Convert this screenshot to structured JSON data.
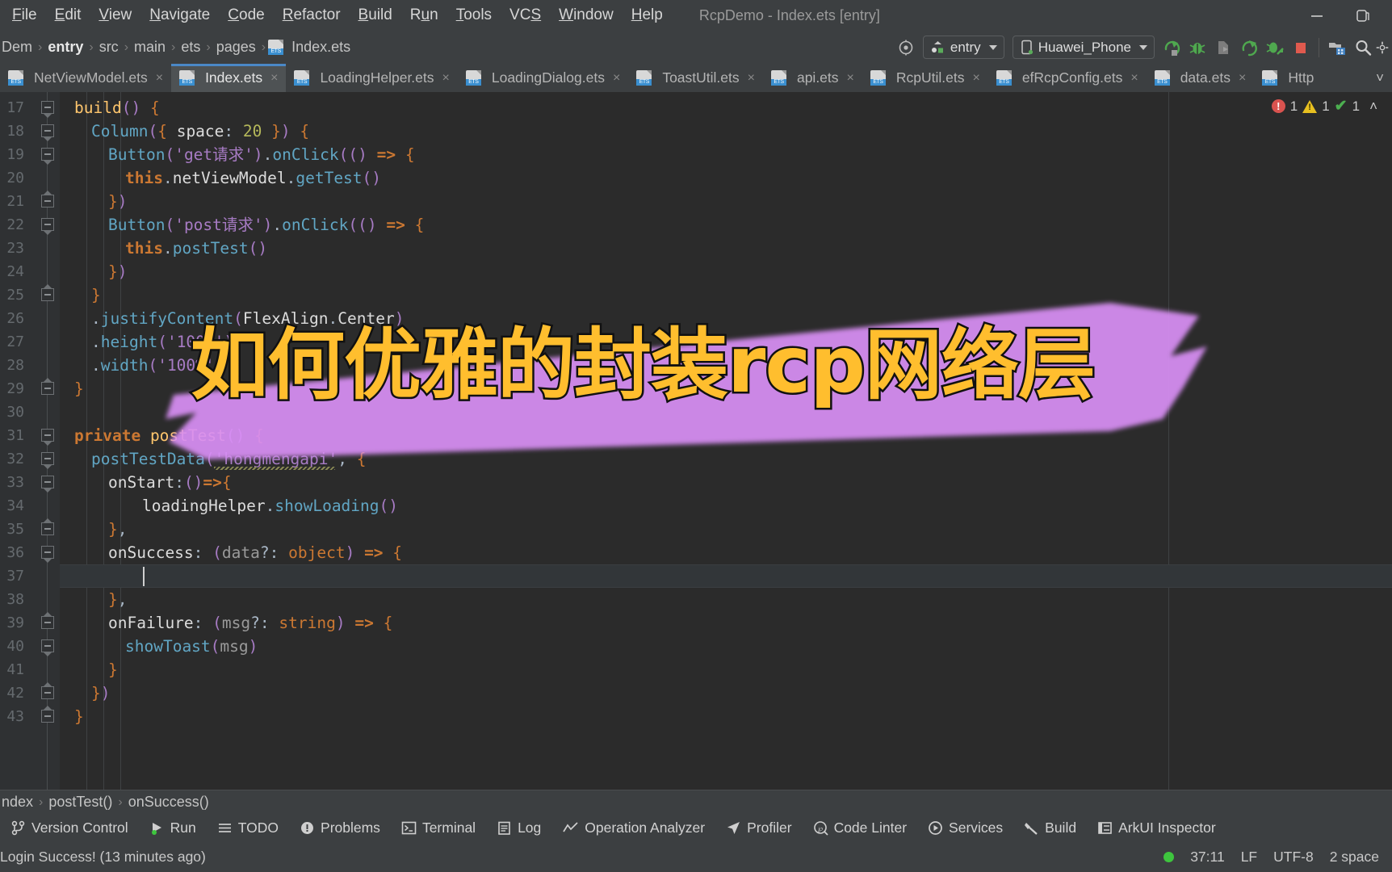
{
  "window": {
    "title": "RcpDemo - Index.ets [entry]",
    "minimize_label": "─",
    "restore_label": "❐"
  },
  "menubar": [
    {
      "label": "File",
      "mnemonic": "F"
    },
    {
      "label": "Edit",
      "mnemonic": "E"
    },
    {
      "label": "View",
      "mnemonic": "V"
    },
    {
      "label": "Navigate",
      "mnemonic": "N"
    },
    {
      "label": "Code",
      "mnemonic": "C"
    },
    {
      "label": "Refactor",
      "mnemonic": "R"
    },
    {
      "label": "Build",
      "mnemonic": "B"
    },
    {
      "label": "Run",
      "mnemonic": "u"
    },
    {
      "label": "Tools",
      "mnemonic": "T"
    },
    {
      "label": "VCS",
      "mnemonic": "S"
    },
    {
      "label": "Window",
      "mnemonic": "W"
    },
    {
      "label": "Help",
      "mnemonic": "H"
    }
  ],
  "breadcrumb": {
    "items": [
      "Dem",
      "entry",
      "src",
      "main",
      "ets",
      "pages",
      "Index.ets"
    ],
    "separator": "›",
    "file_icon": "ets-file-icon"
  },
  "toolbar": {
    "target_icon": "target-icon",
    "run_config": {
      "label": "entry",
      "icon": "module-icon"
    },
    "device": {
      "label": "Huawei_Phone",
      "icon": "phone-icon"
    },
    "actions": [
      {
        "name": "run-button",
        "icon": "run-arrow-icon",
        "color": "#5aab5a"
      },
      {
        "name": "debug-button",
        "icon": "bug-icon",
        "color": "#5aab5a"
      },
      {
        "name": "run-with-coverage",
        "icon": "coverage-icon",
        "color": "#8a8a8a"
      },
      {
        "name": "rerun-button",
        "icon": "rerun-icon",
        "color": "#5aab5a"
      },
      {
        "name": "attach-debugger",
        "icon": "attach-bug-icon",
        "color": "#5aab5a"
      },
      {
        "name": "stop-button",
        "icon": "stop-square-icon",
        "color": "#e05a4e"
      }
    ],
    "right_actions": [
      {
        "name": "project-structure-button",
        "icon": "project-structure-icon"
      },
      {
        "name": "search-everywhere-button",
        "icon": "search-icon"
      },
      {
        "name": "settings-button",
        "icon": "gear-icon"
      }
    ]
  },
  "tabs": {
    "items": [
      {
        "label": "NetViewModel.ets",
        "active": false
      },
      {
        "label": "Index.ets",
        "active": true
      },
      {
        "label": "LoadingHelper.ets",
        "active": false
      },
      {
        "label": "LoadingDialog.ets",
        "active": false
      },
      {
        "label": "ToastUtil.ets",
        "active": false
      },
      {
        "label": "api.ets",
        "active": false
      },
      {
        "label": "RcpUtil.ets",
        "active": false
      },
      {
        "label": "efRcpConfig.ets",
        "active": false
      },
      {
        "label": "data.ets",
        "active": false
      },
      {
        "label": "Http",
        "active": false
      }
    ],
    "close_label": "×",
    "more_label": "˅"
  },
  "inspections": {
    "errors": "1",
    "warnings": "1",
    "ok": "1",
    "collapse_label": "˄",
    "error_glyph": "!",
    "ok_glyph": "✔"
  },
  "editor": {
    "first_line": 17,
    "lines": [
      {
        "n": 17,
        "indent": 0,
        "tokens": [
          [
            "fn",
            "build"
          ],
          [
            "paren",
            "()"
          ],
          [
            "plain",
            " "
          ],
          [
            "brc",
            "{"
          ]
        ]
      },
      {
        "n": 18,
        "indent": 1,
        "tokens": [
          [
            "meth",
            "Column"
          ],
          [
            "paren",
            "("
          ],
          [
            "brc",
            "{"
          ],
          [
            "plain",
            " "
          ],
          [
            "white",
            "space"
          ],
          [
            "plain",
            ": "
          ],
          [
            "num",
            "20"
          ],
          [
            "plain",
            " "
          ],
          [
            "brc",
            "}"
          ],
          [
            "paren",
            ")"
          ],
          [
            "plain",
            " "
          ],
          [
            "brc",
            "{"
          ]
        ]
      },
      {
        "n": 19,
        "indent": 2,
        "tokens": [
          [
            "meth",
            "Button"
          ],
          [
            "paren",
            "("
          ],
          [
            "str",
            "'get请求'"
          ],
          [
            "paren",
            ")"
          ],
          [
            "plain",
            "."
          ],
          [
            "meth",
            "onClick"
          ],
          [
            "paren",
            "(()"
          ],
          [
            "plain",
            " "
          ],
          [
            "kw",
            "=>"
          ],
          [
            "plain",
            " "
          ],
          [
            "brc",
            "{"
          ]
        ]
      },
      {
        "n": 20,
        "indent": 3,
        "tokens": [
          [
            "kw",
            "this"
          ],
          [
            "plain",
            "."
          ],
          [
            "white",
            "netViewModel"
          ],
          [
            "plain",
            "."
          ],
          [
            "meth",
            "getTest"
          ],
          [
            "paren",
            "()"
          ]
        ]
      },
      {
        "n": 21,
        "indent": 2,
        "tokens": [
          [
            "brc",
            "}"
          ],
          [
            "paren",
            ")"
          ]
        ]
      },
      {
        "n": 22,
        "indent": 2,
        "tokens": [
          [
            "meth",
            "Button"
          ],
          [
            "paren",
            "("
          ],
          [
            "str",
            "'post请求'"
          ],
          [
            "paren",
            ")"
          ],
          [
            "plain",
            "."
          ],
          [
            "meth",
            "onClick"
          ],
          [
            "paren",
            "(()"
          ],
          [
            "plain",
            " "
          ],
          [
            "kw",
            "=>"
          ],
          [
            "plain",
            " "
          ],
          [
            "brc",
            "{"
          ]
        ]
      },
      {
        "n": 23,
        "indent": 3,
        "tokens": [
          [
            "kw",
            "this"
          ],
          [
            "plain",
            "."
          ],
          [
            "meth",
            "postTest"
          ],
          [
            "paren",
            "()"
          ]
        ]
      },
      {
        "n": 24,
        "indent": 2,
        "tokens": [
          [
            "brc",
            "}"
          ],
          [
            "paren",
            ")"
          ]
        ]
      },
      {
        "n": 25,
        "indent": 1,
        "tokens": [
          [
            "brc",
            "}"
          ]
        ]
      },
      {
        "n": 26,
        "indent": 1,
        "tokens": [
          [
            "plain",
            "."
          ],
          [
            "meth",
            "justifyContent"
          ],
          [
            "paren",
            "("
          ],
          [
            "white",
            "FlexAlign"
          ],
          [
            "plain",
            "."
          ],
          [
            "white",
            "Center"
          ],
          [
            "paren",
            ")"
          ]
        ]
      },
      {
        "n": 27,
        "indent": 1,
        "tokens": [
          [
            "plain",
            "."
          ],
          [
            "meth",
            "height"
          ],
          [
            "paren",
            "("
          ],
          [
            "str",
            "'100%'"
          ],
          [
            "paren",
            ")"
          ]
        ]
      },
      {
        "n": 28,
        "indent": 1,
        "tokens": [
          [
            "plain",
            "."
          ],
          [
            "meth",
            "width"
          ],
          [
            "paren",
            "("
          ],
          [
            "str",
            "'100%'"
          ],
          [
            "paren",
            ")"
          ]
        ]
      },
      {
        "n": 29,
        "indent": 0,
        "tokens": [
          [
            "brc",
            "}"
          ]
        ]
      },
      {
        "n": 30,
        "indent": 0,
        "tokens": []
      },
      {
        "n": 31,
        "indent": 0,
        "tokens": [
          [
            "kw",
            "private"
          ],
          [
            "plain",
            " "
          ],
          [
            "fn",
            "postTest"
          ],
          [
            "paren",
            "()"
          ],
          [
            "plain",
            " "
          ],
          [
            "brc",
            "{"
          ]
        ]
      },
      {
        "n": 32,
        "indent": 1,
        "tokens": [
          [
            "meth",
            "postTestData"
          ],
          [
            "paren",
            "("
          ],
          [
            "str",
            "'hongmengapi'"
          ],
          [
            "plain",
            ", "
          ],
          [
            "brc",
            "{"
          ]
        ]
      },
      {
        "n": 33,
        "indent": 2,
        "tokens": [
          [
            "white",
            "onStart"
          ],
          [
            "plain",
            ":"
          ],
          [
            "paren",
            "()"
          ],
          [
            "kw",
            "=>"
          ],
          [
            "brc",
            "{"
          ]
        ]
      },
      {
        "n": 34,
        "indent": 4,
        "tokens": [
          [
            "white",
            "loadingHelper"
          ],
          [
            "plain",
            "."
          ],
          [
            "meth",
            "showLoading"
          ],
          [
            "paren",
            "()"
          ]
        ]
      },
      {
        "n": 35,
        "indent": 2,
        "tokens": [
          [
            "brc",
            "}"
          ],
          [
            "plain",
            ","
          ]
        ]
      },
      {
        "n": 36,
        "indent": 2,
        "tokens": [
          [
            "white",
            "onSuccess"
          ],
          [
            "plain",
            ": "
          ],
          [
            "paren",
            "("
          ],
          [
            "param",
            "data"
          ],
          [
            "plain",
            "?: "
          ],
          [
            "type",
            "object"
          ],
          [
            "paren",
            ")"
          ],
          [
            "plain",
            " "
          ],
          [
            "kw",
            "=>"
          ],
          [
            "plain",
            " "
          ],
          [
            "brc",
            "{"
          ]
        ]
      },
      {
        "n": 37,
        "indent": 4,
        "tokens": []
      },
      {
        "n": 38,
        "indent": 2,
        "tokens": [
          [
            "brc",
            "}"
          ],
          [
            "plain",
            ","
          ]
        ]
      },
      {
        "n": 39,
        "indent": 2,
        "tokens": [
          [
            "white",
            "onFailure"
          ],
          [
            "plain",
            ": "
          ],
          [
            "paren",
            "("
          ],
          [
            "param",
            "msg"
          ],
          [
            "plain",
            "?: "
          ],
          [
            "type",
            "string"
          ],
          [
            "paren",
            ")"
          ],
          [
            "plain",
            " "
          ],
          [
            "kw",
            "=>"
          ],
          [
            "plain",
            " "
          ],
          [
            "brc",
            "{"
          ]
        ]
      },
      {
        "n": 40,
        "indent": 3,
        "tokens": [
          [
            "meth",
            "showToast"
          ],
          [
            "paren",
            "("
          ],
          [
            "param",
            "msg"
          ],
          [
            "paren",
            ")"
          ]
        ]
      },
      {
        "n": 41,
        "indent": 2,
        "tokens": [
          [
            "brc",
            "}"
          ]
        ]
      },
      {
        "n": 42,
        "indent": 1,
        "tokens": [
          [
            "brc",
            "}"
          ],
          [
            "paren",
            ")"
          ]
        ]
      },
      {
        "n": 43,
        "indent": 0,
        "tokens": [
          [
            "brc",
            "}"
          ]
        ]
      }
    ],
    "caret_line_index": 20,
    "caret_position": "37:11"
  },
  "overlay": {
    "text": "如何优雅的封装rcp网络层",
    "text_color": "#ffbe2e",
    "stroke_color": "#111111",
    "marker_color": "#d98ff5"
  },
  "bottom_breadcrumb": {
    "items": [
      "ndex",
      "postTest()",
      "onSuccess()"
    ],
    "separator": "›"
  },
  "bottom_toolwindows": [
    {
      "label": "Version Control",
      "icon": "branch-icon"
    },
    {
      "label": "Run",
      "icon": "run-arrow-icon"
    },
    {
      "label": "TODO",
      "icon": "list-icon"
    },
    {
      "label": "Problems",
      "icon": "warning-circle-icon"
    },
    {
      "label": "Terminal",
      "icon": "terminal-icon"
    },
    {
      "label": "Log",
      "icon": "log-icon"
    },
    {
      "label": "Operation Analyzer",
      "icon": "chart-line-icon"
    },
    {
      "label": "Profiler",
      "icon": "profiler-icon"
    },
    {
      "label": "Code Linter",
      "icon": "linter-icon"
    },
    {
      "label": "Services",
      "icon": "services-play-icon"
    },
    {
      "label": "Build",
      "icon": "hammer-icon"
    },
    {
      "label": "ArkUI Inspector",
      "icon": "inspector-icon"
    }
  ],
  "statusbar": {
    "message": "Login Success! (13 minutes ago)",
    "position": "37:11",
    "line_separator": "LF",
    "encoding": "UTF-8",
    "indent": "2 space"
  }
}
